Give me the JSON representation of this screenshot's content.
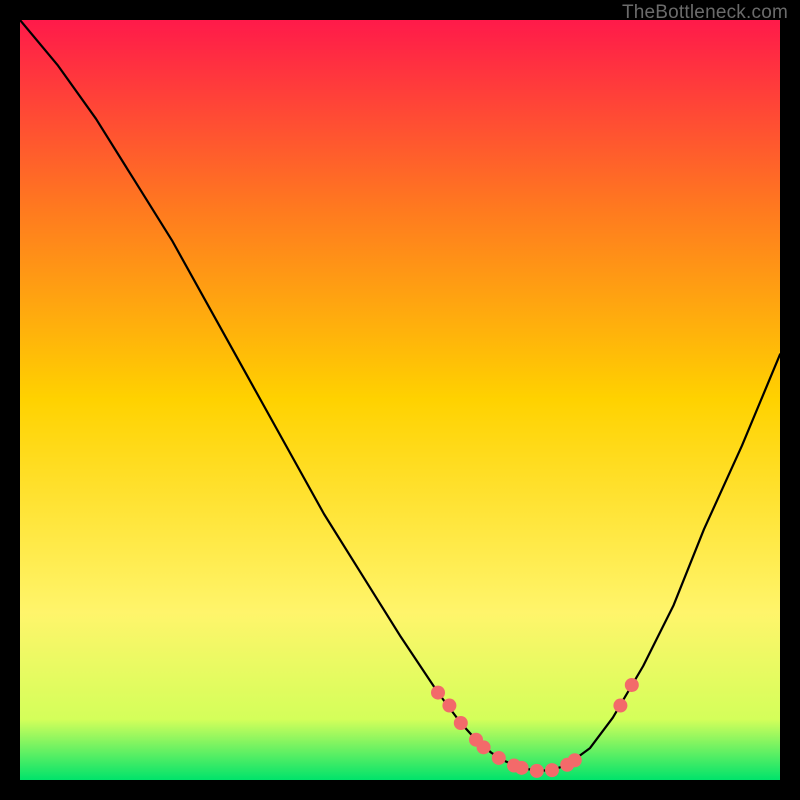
{
  "watermark": "TheBottleneck.com",
  "chart_data": {
    "type": "line",
    "title": "",
    "xlabel": "",
    "ylabel": "",
    "xlim": [
      0,
      100
    ],
    "ylim": [
      0,
      100
    ],
    "gradient_colors": {
      "top": "#ff1a4a",
      "upper_mid": "#ff7a1f",
      "mid": "#ffd200",
      "lower_mid": "#fff56b",
      "near_bottom": "#d4ff5a",
      "bottom": "#00e36b"
    },
    "curve": {
      "x": [
        0,
        5,
        10,
        15,
        20,
        25,
        30,
        35,
        40,
        45,
        50,
        55,
        58,
        60,
        62,
        64,
        66,
        68,
        70,
        72,
        75,
        78,
        82,
        86,
        90,
        95,
        100
      ],
      "y": [
        100,
        94,
        87,
        79,
        71,
        62,
        53,
        44,
        35,
        27,
        19,
        11.5,
        7.5,
        5.3,
        3.6,
        2.4,
        1.6,
        1.2,
        1.3,
        2.0,
        4.2,
        8.2,
        15,
        23,
        33,
        44,
        56
      ]
    },
    "markers": {
      "x": [
        55,
        56.5,
        58,
        60,
        61,
        63,
        65,
        66,
        68,
        70,
        72,
        73,
        79,
        80.5
      ],
      "y": [
        11.5,
        9.8,
        7.5,
        5.3,
        4.3,
        2.9,
        1.9,
        1.6,
        1.2,
        1.3,
        2.0,
        2.6,
        9.8,
        12.5
      ]
    },
    "marker_color": "#f36a6a",
    "curve_color": "#000000"
  }
}
